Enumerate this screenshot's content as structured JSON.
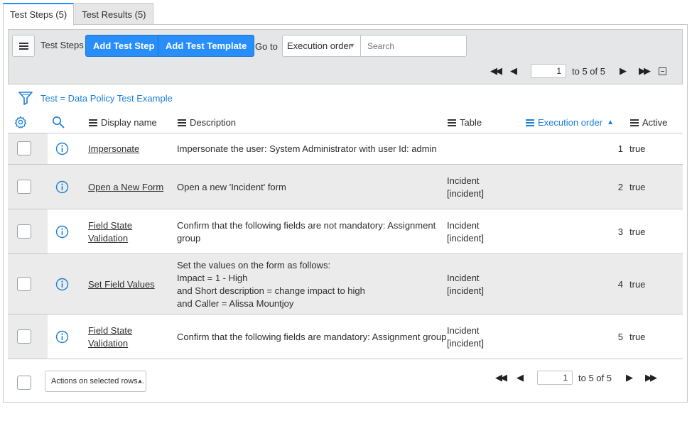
{
  "tabs": [
    {
      "label": "Test Steps (5)",
      "active": true
    },
    {
      "label": "Test Results (5)",
      "active": false
    }
  ],
  "toolbar": {
    "list_title": "Test Steps",
    "add_step_label": "Add Test Step",
    "add_template_label": "Add Test Template",
    "goto_label": "Go to",
    "goto_field_selected": "Execution order",
    "search_placeholder": "Search"
  },
  "pager_top": {
    "page_value": "1",
    "range_text": "to 5 of 5"
  },
  "filter": {
    "text": "Test = Data Policy Test Example"
  },
  "columns": [
    {
      "label": "Display name",
      "sorted": false
    },
    {
      "label": "Description",
      "sorted": false
    },
    {
      "label": "Table",
      "sorted": false
    },
    {
      "label": "Execution order",
      "sorted": true,
      "sort_dir": "asc"
    },
    {
      "label": "Active",
      "sorted": false
    }
  ],
  "rows": [
    {
      "display_name": [
        "Impersonate"
      ],
      "description": [
        "Impersonate the user: System Administrator with user Id: admin"
      ],
      "table": [],
      "execution_order": "1",
      "active": "true"
    },
    {
      "display_name": [
        "Open a New Form"
      ],
      "description": [
        "Open a new 'Incident' form"
      ],
      "table": [
        "Incident",
        "[incident]"
      ],
      "execution_order": "2",
      "active": "true"
    },
    {
      "display_name": [
        "Field State",
        "Validation"
      ],
      "description": [
        "Confirm that the following fields are not mandatory: Assignment",
        "group"
      ],
      "table": [
        "Incident",
        "[incident]"
      ],
      "execution_order": "3",
      "active": "true"
    },
    {
      "display_name": [
        "Set Field Values"
      ],
      "description": [
        "Set the values on the form as follows:",
        "Impact = 1 - High",
        "and Short description = change impact to high",
        "and Caller = Alissa Mountjoy"
      ],
      "table": [
        "Incident",
        "[incident]"
      ],
      "execution_order": "4",
      "active": "true"
    },
    {
      "display_name": [
        "Field State",
        "Validation"
      ],
      "description": [
        "Confirm that the following fields are mandatory: Assignment group"
      ],
      "table": [
        "Incident",
        "[incident]"
      ],
      "execution_order": "5",
      "active": "true"
    }
  ],
  "footer": {
    "actions_label": "Actions on selected rows...",
    "page_value": "1",
    "range_text": "to 5 of 5"
  },
  "colors": {
    "accent": "#278efc",
    "link": "#1a7fd9",
    "toolbar_bg": "#e4e6e7",
    "alt_row": "#ebebeb"
  },
  "icons": [
    "hamburger-icon",
    "first-page-icon",
    "prev-page-icon",
    "next-page-icon",
    "last-page-icon",
    "collapse-icon",
    "filter-funnel-icon",
    "gear-icon",
    "search-icon",
    "column-menu-icon",
    "sort-ascending-icon",
    "info-circle-icon"
  ]
}
